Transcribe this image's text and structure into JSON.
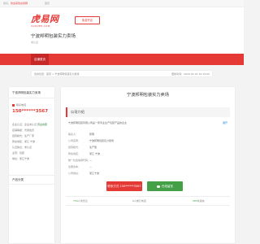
{
  "topbar": {
    "welcome_prefix": "您好，",
    "welcome_link": "欢迎来到虎易网",
    "home_link": "首页"
  },
  "header": {
    "logo_cn": "虎易网",
    "logo_en": "COOVEE.COM",
    "free_button": "免费开店",
    "company_name": "宁波邦明包装实力卖场",
    "company_sub": "未认证"
  },
  "nav": {
    "active_item": "店铺首页"
  },
  "breadcrumb": {
    "trail": "您的位置：首页 > 宁波邦明包装实力卖场",
    "updated": "更新时间：2020-01-24 10:19:00"
  },
  "sidebar": {
    "title": "宁波邦明包装实力卖场",
    "phone_label": "联系电话",
    "phone": "150******3567",
    "rows": [
      {
        "label": "企业认证：",
        "value": "企业未认证",
        "tag": "营业执照"
      },
      {
        "label": "店铺等级：",
        "value": "普通会员"
      },
      {
        "label": "经营模式：",
        "value": "生产厂家"
      },
      {
        "label": "所在地区：",
        "value": "浙江 宁波"
      },
      {
        "label": "认证信息：",
        "value": "未认证"
      },
      {
        "label": "主营：",
        "value": "包装"
      },
      {
        "label": "地址：",
        "value": "浙江宁波"
      }
    ],
    "products_title": "产品分类"
  },
  "main": {
    "title": "宁波邦明包装实力卖场",
    "section_title": "公司介绍",
    "intro": "宁波邦明包装有限公司是一家专业生产包装产品的企业",
    "more_link": "展开",
    "fields": [
      {
        "label": "联系人：",
        "value": "邦明"
      },
      {
        "label": "公司名称：",
        "value": "宁波邦明包装实力卖场"
      },
      {
        "label": "经营模式：",
        "value": "生产型"
      },
      {
        "label": "所在地区：",
        "value": "浙江 宁波"
      },
      {
        "label": "统一社会信用代码：",
        "value": "—"
      },
      {
        "label": "注册资本：",
        "value": "—"
      },
      {
        "label": "公司地址：",
        "value": "浙江宁波"
      }
    ],
    "call_button": "联系方式 150******3567",
    "wechat_button": "在线留言",
    "stats": [
      {
        "prefix": "",
        "number": "759",
        "suffix": "人浏览过"
      },
      {
        "prefix": "",
        "number": "0",
        "suffix": "人拨打电话"
      },
      {
        "prefix": "",
        "number": "285",
        "suffix": "条留言"
      }
    ]
  },
  "colors": {
    "brand_red": "#e53935",
    "accent_green": "#43a047",
    "link_blue": "#1e88e5"
  }
}
